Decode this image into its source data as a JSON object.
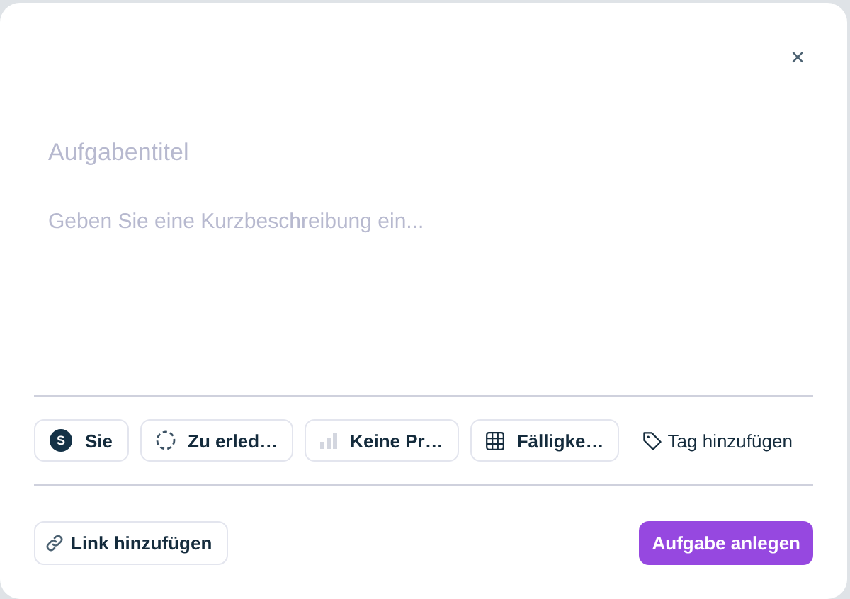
{
  "dialog": {
    "close": "×"
  },
  "title_field": {
    "placeholder": "Aufgabentitel"
  },
  "description_field": {
    "placeholder": "Geben Sie eine Kurzbeschreibung ein..."
  },
  "chips": [
    {
      "kind": "assignee",
      "avatar": "S",
      "label": "Sie"
    },
    {
      "kind": "status",
      "label": "Zu erled…"
    },
    {
      "kind": "priority",
      "label": "Keine Pr…"
    },
    {
      "kind": "due",
      "label": "Fälligke…"
    },
    {
      "kind": "tag",
      "label": "Tag hinzufügen"
    }
  ],
  "link_button": "Link hinzufügen",
  "submit_button": "Aufgabe anlegen"
}
